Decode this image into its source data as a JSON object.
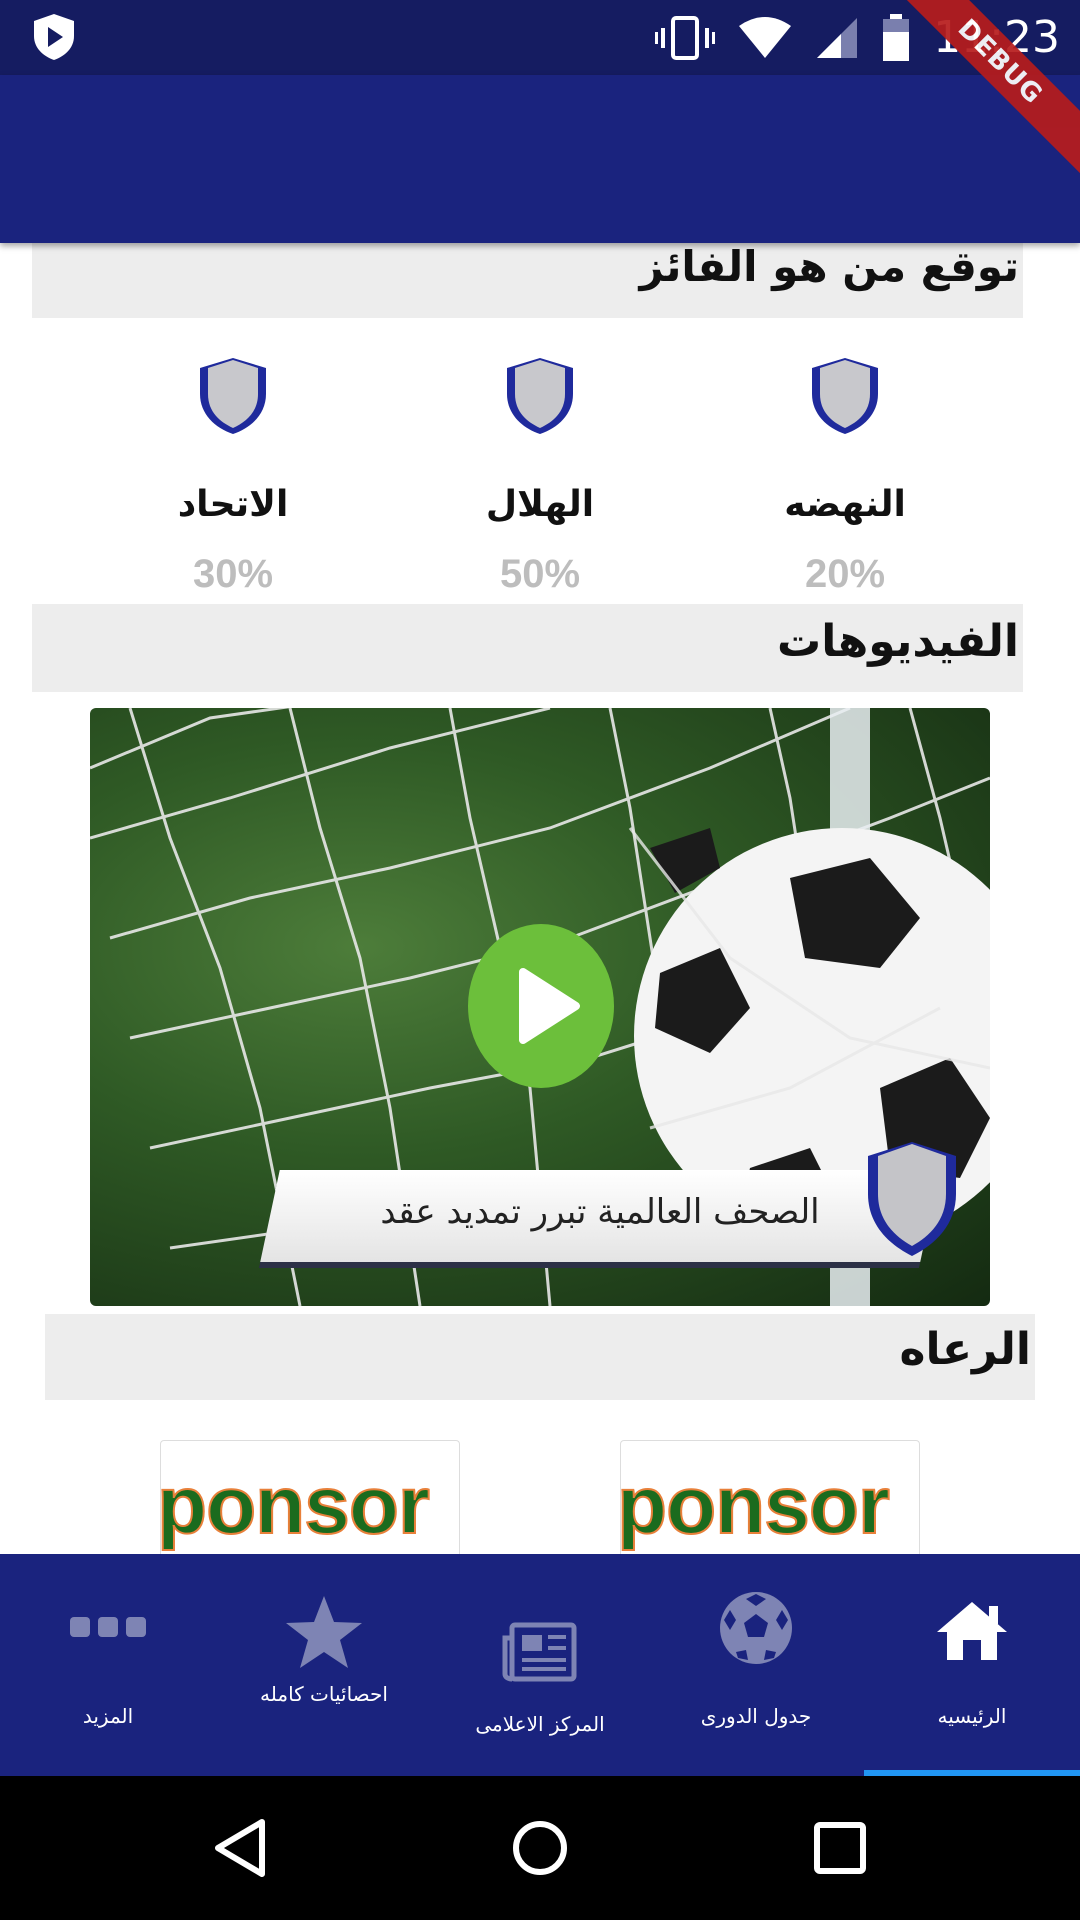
{
  "status_bar": {
    "time": "11:23",
    "debug_label": "DEBUG"
  },
  "prediction": {
    "title": "توقع من هو الفائز",
    "teams": [
      {
        "name": "النهضه",
        "percent": "20%"
      },
      {
        "name": "الهلال",
        "percent": "50%"
      },
      {
        "name": "الاتحاد",
        "percent": "30%"
      }
    ]
  },
  "videos": {
    "title": "الفيديوهات",
    "caption": "الصحف العالمية تبرر تمديد عقد"
  },
  "sponsors": {
    "title": "الرعاه",
    "items": [
      {
        "label": "ponsor"
      },
      {
        "label": "ponsor"
      }
    ]
  },
  "bottom_nav": {
    "items": [
      {
        "label": "الرئيسيه",
        "icon": "home-icon",
        "active": true
      },
      {
        "label": "جدول الدورى",
        "icon": "soccer-ball-icon",
        "active": false
      },
      {
        "label": "المركز الاعلامى",
        "icon": "newspaper-icon",
        "active": false
      },
      {
        "label": "احصائيات كامله",
        "icon": "star-icon",
        "active": false
      },
      {
        "label": "المزيد",
        "icon": "more-icon",
        "active": false
      }
    ]
  },
  "colors": {
    "primary": "#1a237e",
    "status_bar": "#151c61",
    "indicator": "#2196f3",
    "section_bg": "#ededed"
  }
}
